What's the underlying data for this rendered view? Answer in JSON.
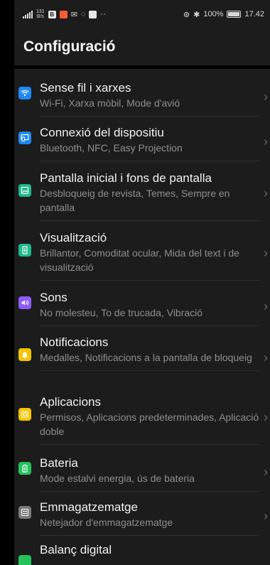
{
  "status_bar": {
    "speed_value": "131",
    "speed_unit": "B/s",
    "battery": "100%",
    "time": "17.42",
    "notif_b": "B",
    "notif_m": "M"
  },
  "title": "Configuració",
  "items": [
    {
      "title": "Sense fil i xarxes",
      "subtitle": "Wi-Fi, Xarxa mòbil, Mode d'avió",
      "icon": "wifi-icon",
      "color": "#1e88f5"
    },
    {
      "title": "Connexió del dispositiu",
      "subtitle": "Bluetooth, NFC, Easy Projection",
      "icon": "device-connection-icon",
      "color": "#1e88f5"
    },
    {
      "title": "Pantalla inicial i fons de pantalla",
      "subtitle": "Desbloqueig de revista, Temes, Sempre en pantalla",
      "icon": "wallpaper-icon",
      "color": "#1fb88a"
    },
    {
      "title": "Visualització",
      "subtitle": "Brillantor, Comoditat ocular, Mida del text i de visualització",
      "icon": "display-icon",
      "color": "#1fb88a"
    },
    {
      "title": "Sons",
      "subtitle": "No molesteu, To de trucada, Vibració",
      "icon": "sound-icon",
      "color": "#8b5cf6"
    },
    {
      "title": "Notificacions",
      "subtitle": "Medalles, Notificacions a la pantalla de bloqueig",
      "icon": "bell-icon",
      "color": "#f5c400"
    },
    {
      "title": "Aplicacions",
      "subtitle": "Permisos, Aplicacions predeterminades, Aplicació doble",
      "icon": "apps-icon",
      "color": "#f5c400"
    },
    {
      "title": "Bateria",
      "subtitle": "Mode estalvi energia, ús de bateria",
      "icon": "battery-icon",
      "color": "#24c35c"
    },
    {
      "title": "Emmagatzematge",
      "subtitle": "Netejador d'emmagatzematge",
      "icon": "storage-icon",
      "color": "#7a7a7a"
    },
    {
      "title": "Balanç digital",
      "subtitle": "",
      "icon": "digital-balance-icon",
      "color": "#24c35c"
    }
  ]
}
